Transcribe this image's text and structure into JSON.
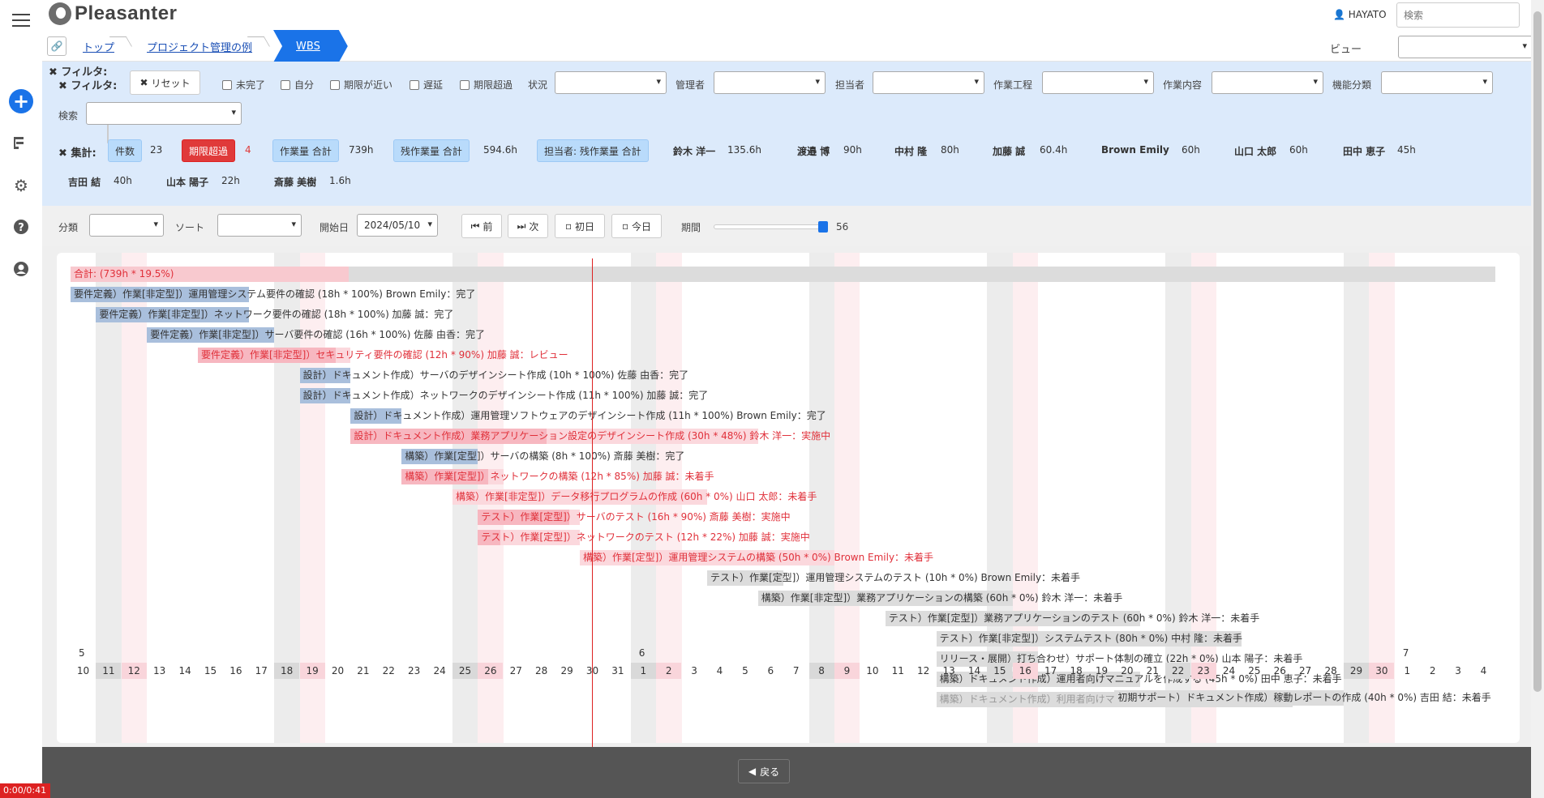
{
  "app": {
    "name": "Pleasanter",
    "user": "HAYATO",
    "search_placeholder": "検索"
  },
  "breadcrumb": {
    "items": [
      "トップ",
      "プロジェクト管理の例",
      "WBS"
    ]
  },
  "view": {
    "label": "ビュー",
    "value": ""
  },
  "filters": {
    "title": "フィルタ:",
    "reset": "リセット",
    "checks": [
      "未完了",
      "自分",
      "期限が近い",
      "遅延",
      "期限超過"
    ],
    "selects": [
      "状況",
      "管理者",
      "担当者",
      "作業工程",
      "作業内容",
      "機能分類"
    ],
    "search_label": "検索"
  },
  "summary": {
    "title": "集計:",
    "count_label": "件数",
    "count": "23",
    "overdue_label": "期限超過",
    "overdue": "4",
    "work_total_label": "作業量 合計",
    "work_total": "739h",
    "remain_total_label": "残作業量 合計",
    "remain_total": "594.6h",
    "assignee_label": "担当者: 残作業量 合計",
    "people": [
      {
        "name": "鈴木 洋一",
        "value": "135.6h"
      },
      {
        "name": "渡邉 博",
        "value": "90h"
      },
      {
        "name": "中村 隆",
        "value": "80h"
      },
      {
        "name": "加藤 誠",
        "value": "60.4h"
      },
      {
        "name": "Brown Emily",
        "value": "60h"
      },
      {
        "name": "山口 太郎",
        "value": "60h"
      },
      {
        "name": "田中 恵子",
        "value": "45h"
      },
      {
        "name": "吉田 結",
        "value": "40h"
      },
      {
        "name": "山本 陽子",
        "value": "22h"
      },
      {
        "name": "斎藤 美樹",
        "value": "1.6h"
      }
    ]
  },
  "controls": {
    "group_label": "分類",
    "sort_label": "ソート",
    "start_label": "開始日",
    "start_date": "2024/05/10",
    "prev": "前",
    "next": "次",
    "first": "初日",
    "today": "今日",
    "period_label": "期間",
    "period": "56"
  },
  "gantt": {
    "total_label": "合計: (739h * 19.5%)",
    "tasks": [
      {
        "text": "要件定義）作業[非定型]）運用管理システム要件の確認 (18h * 100%) Brown Emily：完了",
        "start": 0,
        "days": 7,
        "done": 1,
        "red": false
      },
      {
        "text": "要件定義）作業[非定型]）ネットワーク要件の確認 (18h * 100%) 加藤 誠：完了",
        "start": 1,
        "days": 6,
        "done": 1,
        "red": false
      },
      {
        "text": "要件定義）作業[非定型]）サーバ要件の確認 (16h * 100%) 佐藤 由香：完了",
        "start": 3,
        "days": 5,
        "done": 1,
        "red": false
      },
      {
        "text": "要件定義）作業[非定型]）セキュリティ要件の確認 (12h * 90%) 加藤 誠：レビュー",
        "start": 5,
        "days": 6,
        "done": 0.9,
        "red": true
      },
      {
        "text": "設計）ドキュメント作成）サーバのデザインシート作成 (10h * 100%) 佐藤 由香：完了",
        "start": 9,
        "days": 2,
        "done": 1,
        "red": false
      },
      {
        "text": "設計）ドキュメント作成）ネットワークのデザインシート作成 (11h * 100%) 加藤 誠：完了",
        "start": 9,
        "days": 2,
        "done": 1,
        "red": false
      },
      {
        "text": "設計）ドキュメント作成）運用管理ソフトウェアのデザインシート作成 (11h * 100%) Brown Emily：完了",
        "start": 11,
        "days": 2,
        "done": 1,
        "red": false
      },
      {
        "text": "設計）ドキュメント作成）業務アプリケーション設定のデザインシート作成 (30h * 48%) 鈴木 洋一：実施中",
        "start": 11,
        "days": 16,
        "done": 0.48,
        "red": true
      },
      {
        "text": "構築）作業[定型]）サーバの構築 (8h * 100%) 斎藤 美樹：完了",
        "start": 13,
        "days": 3,
        "done": 1,
        "red": false
      },
      {
        "text": "構築）作業[定型]）ネットワークの構築 (12h * 85%) 加藤 誠：未着手",
        "start": 13,
        "days": 4,
        "done": 0.85,
        "red": true
      },
      {
        "text": "構築）作業[非定型]）データ移行プログラムの作成 (60h * 0%) 山口 太郎：未着手",
        "start": 15,
        "days": 10,
        "done": 0,
        "red": true
      },
      {
        "text": "テスト）作業[定型]）サーバのテスト (16h * 90%) 斎藤 美樹：実施中",
        "start": 16,
        "days": 4,
        "done": 0.9,
        "red": true
      },
      {
        "text": "テスト）作業[定型]）ネットワークのテスト (12h * 22%) 加藤 誠：実施中",
        "start": 16,
        "days": 4,
        "done": 0.22,
        "red": true
      },
      {
        "text": "構築）作業[定型]）運用管理システムの構築 (50h * 0%) Brown Emily：未着手",
        "start": 20,
        "days": 10,
        "done": 0,
        "red": true
      },
      {
        "text": "テスト）作業[定型]）運用管理システムのテスト (10h * 0%) Brown Emily：未着手",
        "start": 25,
        "days": 3,
        "done": 0,
        "red": false
      },
      {
        "text": "構築）作業[非定型]）業務アプリケーションの構築 (60h * 0%) 鈴木 洋一：未着手",
        "start": 27,
        "days": 10,
        "done": 0,
        "red": false
      },
      {
        "text": "テスト）作業[定型]）業務アプリケーションのテスト (60h * 0%) 鈴木 洋一：未着手",
        "start": 32,
        "days": 10,
        "done": 0,
        "red": false
      },
      {
        "text": "テスト）作業[非定型]）システムテスト (80h * 0%) 中村 隆：未着手",
        "start": 34,
        "days": 12,
        "done": 0,
        "red": false
      },
      {
        "text": "リリース・展開）打ち合わせ）サポート体制の確立 (22h * 0%) 山本 陽子：未着手",
        "start": 34,
        "days": 4,
        "done": 0,
        "red": false
      },
      {
        "text": "構築）ドキュメント作成）運用者向けマニュアルを作成する (45h * 0%) 田中 恵子：未着手",
        "start": 34,
        "days": 8,
        "done": 0,
        "red": false
      },
      {
        "text": "構築）ドキュメント作成）利用者向けマニュアルを作成する (90h * 0%) 渡邉 博：未着手",
        "start": 34,
        "days": 14,
        "done": 0,
        "red": false
      },
      {
        "text": "初期サポート）ドキュメント作成）稼動レポートの作成 (40h * 0%) 吉田 結：未着手",
        "start": 41,
        "days": 9,
        "done": 0,
        "red": false
      }
    ],
    "months": [
      {
        "label": "5",
        "index": 0
      },
      {
        "label": "6",
        "index": 22
      },
      {
        "label": "7",
        "index": 52
      }
    ],
    "days": [
      "10",
      "11",
      "12",
      "13",
      "14",
      "15",
      "16",
      "17",
      "18",
      "19",
      "20",
      "21",
      "22",
      "23",
      "24",
      "25",
      "26",
      "27",
      "28",
      "29",
      "30",
      "31",
      "1",
      "2",
      "3",
      "4",
      "5",
      "6",
      "7",
      "8",
      "9",
      "10",
      "11",
      "12",
      "13",
      "14",
      "15",
      "16",
      "17",
      "18",
      "19",
      "20",
      "21",
      "22",
      "23",
      "24",
      "25",
      "26",
      "27",
      "28",
      "29",
      "30",
      "1",
      "2",
      "3",
      "4"
    ],
    "weekend_sat": [
      1,
      8,
      15,
      22,
      29,
      36,
      43,
      50
    ],
    "weekend_sun": [
      2,
      9,
      16,
      23,
      30,
      37,
      44,
      51
    ]
  },
  "footer": {
    "back": "戻る",
    "timer": "0:00/0:41"
  }
}
